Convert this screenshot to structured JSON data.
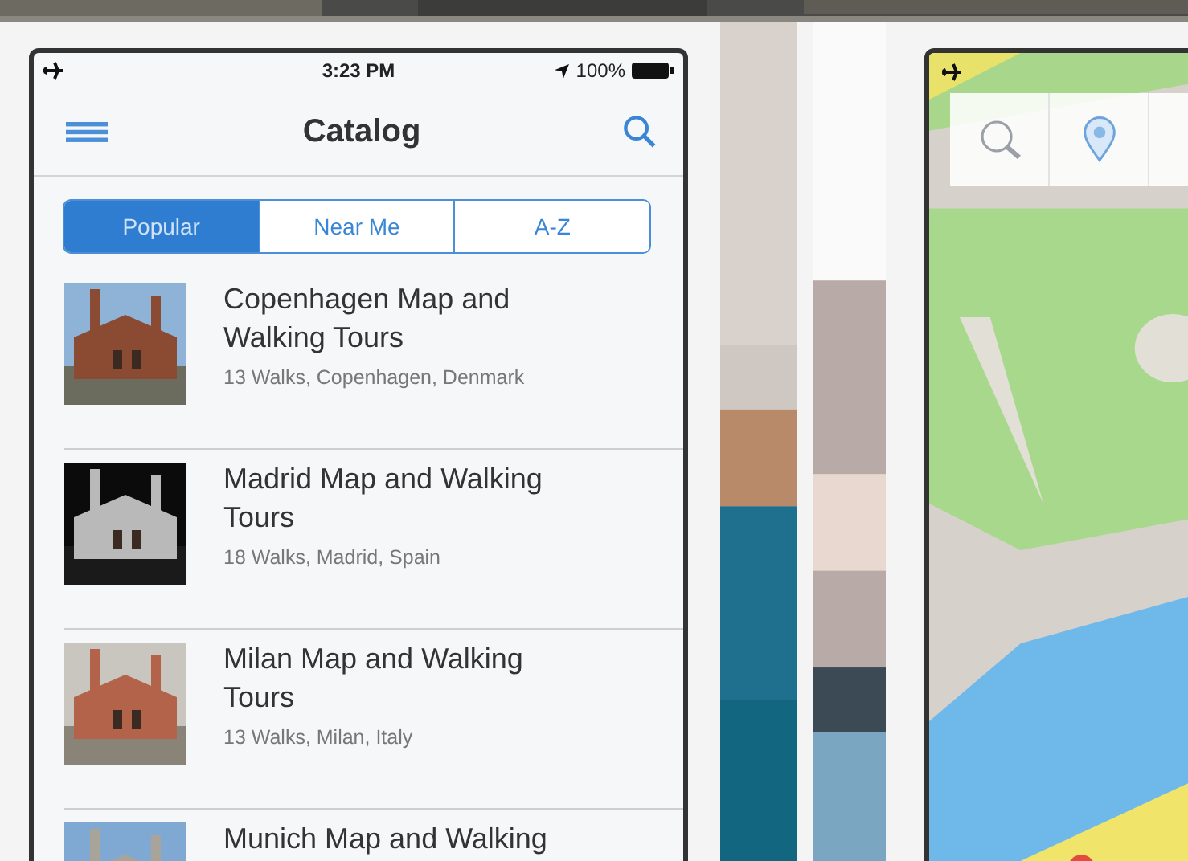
{
  "left_phone": {
    "status_bar": {
      "time": "3:23 PM",
      "battery": "100%"
    },
    "nav_bar": {
      "title": "Catalog"
    },
    "segments": [
      {
        "label": "Popular",
        "selected": true
      },
      {
        "label": "Near Me",
        "selected": false
      },
      {
        "label": "A-Z",
        "selected": false
      }
    ],
    "catalog": [
      {
        "title": "Copenhagen Map and Walking Tours",
        "subtitle": "13 Walks, Copenhagen, Denmark"
      },
      {
        "title": "Madrid Map and Walking Tours",
        "subtitle": "18 Walks, Madrid, Spain"
      },
      {
        "title": "Milan Map and Walking Tours",
        "subtitle": "13 Walks, Milan, Italy"
      },
      {
        "title": "Munich Map and Walking"
      }
    ]
  }
}
